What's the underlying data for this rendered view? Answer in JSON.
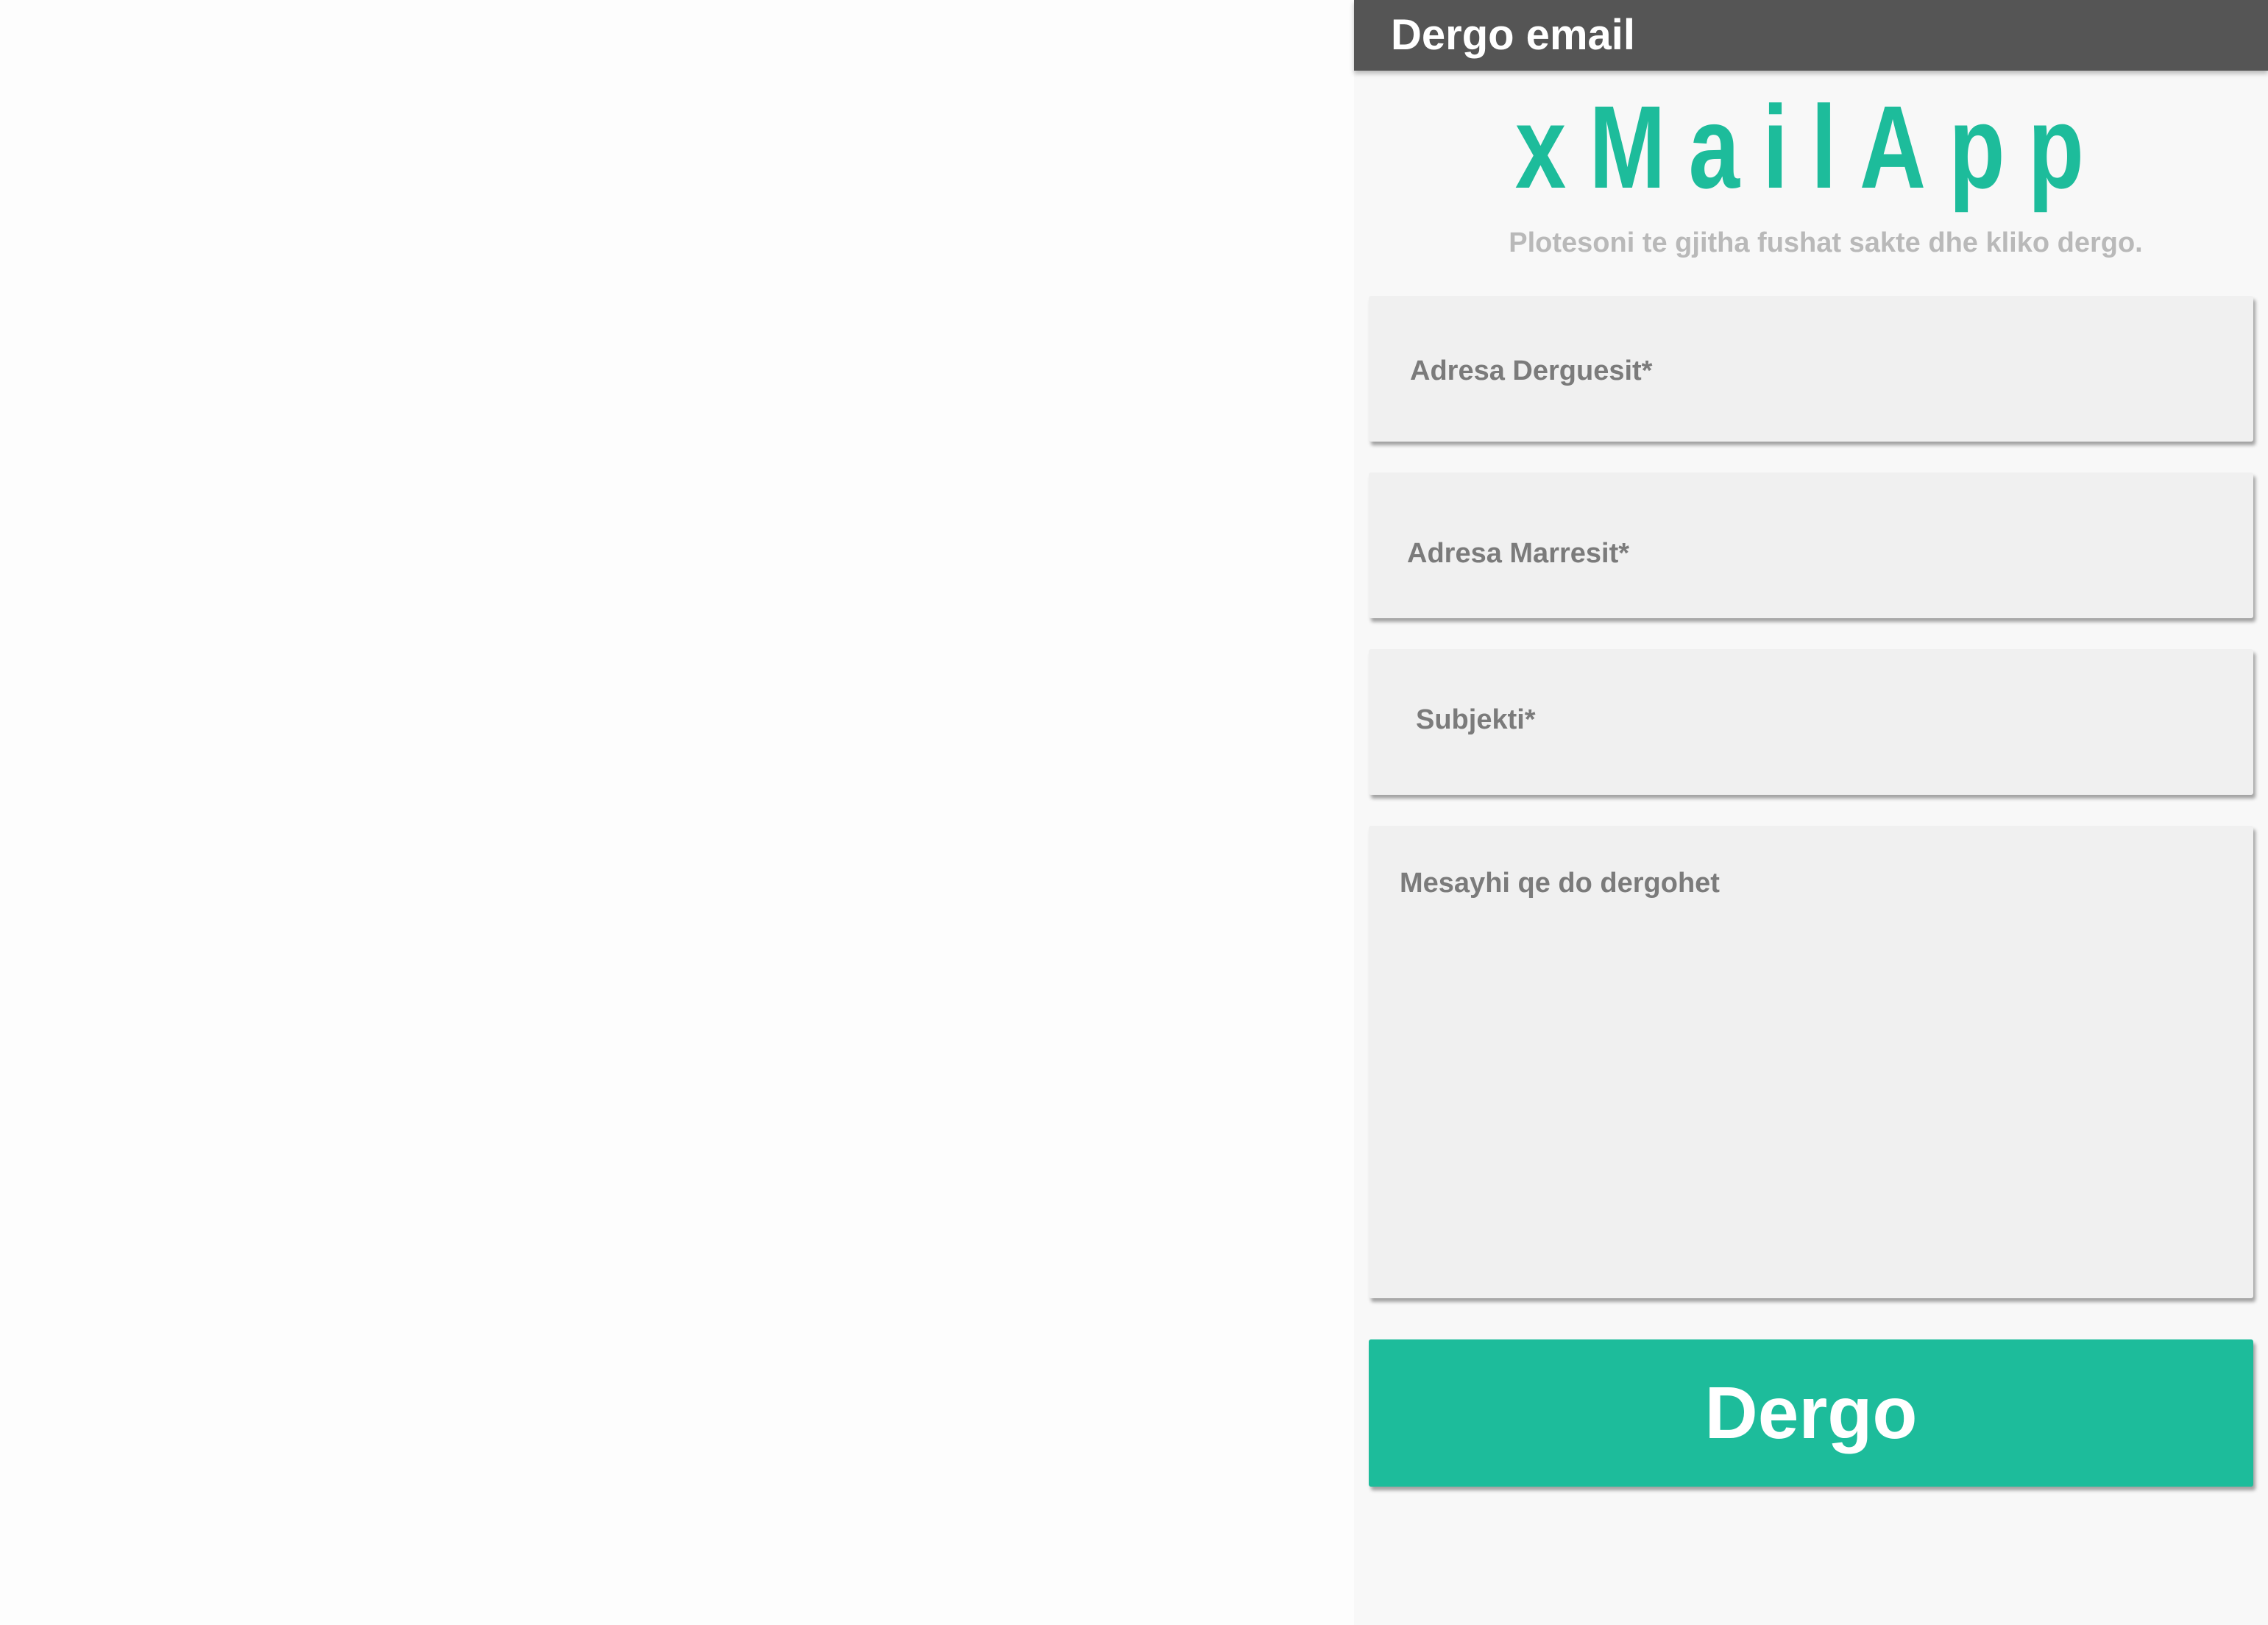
{
  "header": {
    "title": "Dergo email"
  },
  "logo": {
    "text": "xMailApp"
  },
  "instructions": "Plotesoni te gjitha fushat sakte dhe kliko dergo.",
  "form": {
    "sender_placeholder": "Adresa Derguesit*",
    "recipient_placeholder": "Adresa Marresit*",
    "subject_placeholder": "Subjekti*",
    "message_placeholder": "Mesayhi qe do dergohet"
  },
  "actions": {
    "send_label": "Dergo"
  },
  "colors": {
    "accent": "#1dbc9b",
    "titlebar": "#555555",
    "field_bg": "#f0f0f0",
    "placeholder": "#7b7b7b"
  }
}
